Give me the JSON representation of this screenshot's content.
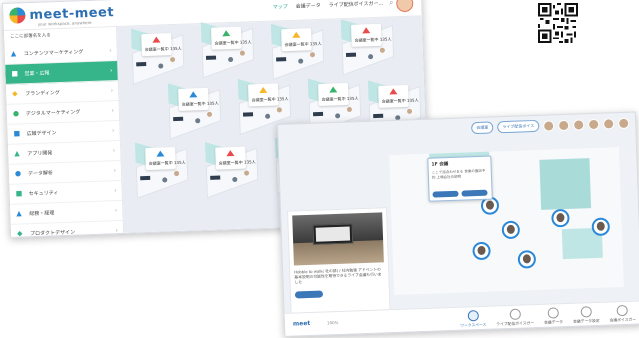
{
  "main": {
    "logo": "meet-meet",
    "logo_sub": "your workspace, anywhere",
    "topnav": [
      "マップ",
      "会議データ",
      "ライブ配信ボイスガー..."
    ],
    "sidebar_header": "ここに部署名を入る",
    "sidebar_items": [
      {
        "label": "コンテンツマーケティング",
        "active": false
      },
      {
        "label": "営業・広報",
        "active": true
      },
      {
        "label": "ブランディング",
        "active": false
      },
      {
        "label": "デジタルマーケティング",
        "active": false
      },
      {
        "label": "広報デザイン",
        "active": false
      },
      {
        "label": "アプリ開発",
        "active": false
      },
      {
        "label": "データ解析",
        "active": false
      },
      {
        "label": "セキュリティ",
        "active": false
      },
      {
        "label": "総務・経理",
        "active": false
      },
      {
        "label": "プロダクトデザイン",
        "active": false
      }
    ],
    "room_count_label": "会議室一覧中 135人",
    "accent": "#36b58a"
  },
  "second": {
    "top_pills": [
      "会議室",
      "ライブ配信ボイス"
    ],
    "popup_title": "1F 会議",
    "popup_text": "ここで話合わせまる 営業の面談予約 上場会社の説明",
    "caption": "Hobble to walk( 社の部) / 社内勉強 アドベントの基本説明の可能性を期待できるライブ会議も行いました",
    "bottom_logo": "meet",
    "bottom_pct": "100%",
    "bottom_nav": [
      {
        "label": "ワークスペース",
        "active": true
      },
      {
        "label": "ライブ配信ボイスガー",
        "active": false
      },
      {
        "label": "会議データ",
        "active": false
      },
      {
        "label": "会議データ設定",
        "active": false
      },
      {
        "label": "会議ボイスガー",
        "active": false
      }
    ],
    "accent": "#3c78b8"
  }
}
